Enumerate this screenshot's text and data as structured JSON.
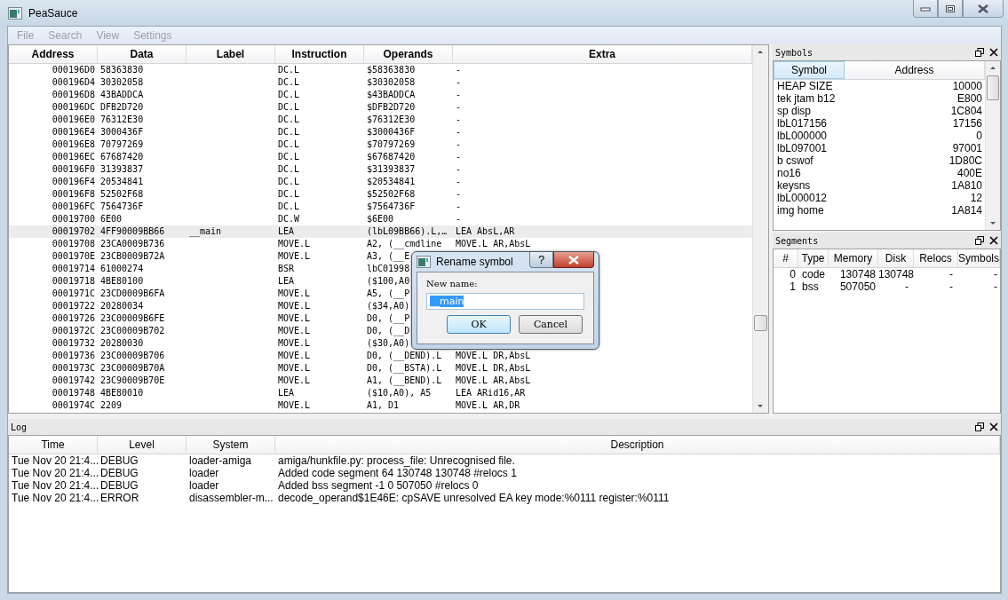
{
  "window": {
    "title": "PeaSauce"
  },
  "menu": [
    {
      "label": "File",
      "disabled": true
    },
    {
      "label": "Search",
      "disabled": true
    },
    {
      "label": "View",
      "disabled": true
    },
    {
      "label": "Settings",
      "disabled": true
    }
  ],
  "disassembly": {
    "columns": [
      "Address",
      "Data",
      "Label",
      "Instruction",
      "Operands",
      "Extra"
    ],
    "rows": [
      {
        "address": "000196D0",
        "data": "58363830",
        "instruction": "DC.L",
        "operands": "$58363830",
        "extra": "-",
        "selected": false
      },
      {
        "address": "000196D4",
        "data": "30302058",
        "instruction": "DC.L",
        "operands": "$30302058",
        "extra": "-",
        "selected": false
      },
      {
        "address": "000196D8",
        "data": "43BADDCA",
        "instruction": "DC.L",
        "operands": "$43BADDCA",
        "extra": "-",
        "selected": false
      },
      {
        "address": "000196DC",
        "data": "DFB2D720",
        "instruction": "DC.L",
        "operands": "$DFB2D720",
        "extra": "-",
        "selected": false
      },
      {
        "address": "000196E0",
        "data": "76312E30",
        "instruction": "DC.L",
        "operands": "$76312E30",
        "extra": "-",
        "selected": false
      },
      {
        "address": "000196E4",
        "data": "3000436F",
        "instruction": "DC.L",
        "operands": "$3000436F",
        "extra": "-",
        "selected": false
      },
      {
        "address": "000196E8",
        "data": "70797269",
        "instruction": "DC.L",
        "operands": "$70797269",
        "extra": "-",
        "selected": false
      },
      {
        "address": "000196EC",
        "data": "67687420",
        "instruction": "DC.L",
        "operands": "$67687420",
        "extra": "-",
        "selected": false
      },
      {
        "address": "000196F0",
        "data": "31393837",
        "instruction": "DC.L",
        "operands": "$31393837",
        "extra": "-",
        "selected": false
      },
      {
        "address": "000196F4",
        "data": "20534841",
        "instruction": "DC.L",
        "operands": "$20534841",
        "extra": "-",
        "selected": false
      },
      {
        "address": "000196F8",
        "data": "52502F68",
        "instruction": "DC.L",
        "operands": "$52502F68",
        "extra": "-",
        "selected": false
      },
      {
        "address": "000196FC",
        "data": "7564736F",
        "instruction": "DC.L",
        "operands": "$7564736F",
        "extra": "-",
        "selected": false
      },
      {
        "address": "00019700",
        "data": "6E00",
        "instruction": "DC.W",
        "operands": "$6E00",
        "extra": "-",
        "selected": false
      },
      {
        "address": "00019702",
        "data": "4FF90009BB66",
        "label": "__main",
        "instruction": "LEA",
        "operands": "(lbL09BB66).L,…",
        "extra": "LEA AbsL,AR",
        "selected": true
      },
      {
        "address": "00019708",
        "data": "23CA0009B736",
        "instruction": "MOVE.L",
        "operands": "A2, (__cmdline",
        "extra": "MOVE.L AR,AbsL",
        "selected": false
      },
      {
        "address": "0001970E",
        "data": "23CB0009B72A",
        "instruction": "MOVE.L",
        "operands": "A3, (__E",
        "selected": false
      },
      {
        "address": "00019714",
        "data": "61000274",
        "instruction": "BSR",
        "operands": "lbC01998",
        "selected": false
      },
      {
        "address": "00019718",
        "data": "4BE80100",
        "instruction": "LEA",
        "operands": "($100,A0",
        "selected": false
      },
      {
        "address": "0001971C",
        "data": "23CD0009B6FA",
        "instruction": "MOVE.L",
        "operands": "A5, (__P",
        "selected": false
      },
      {
        "address": "00019722",
        "data": "20280034",
        "instruction": "MOVE.L",
        "operands": "($34,A0)",
        "selected": false
      },
      {
        "address": "00019726",
        "data": "23C00009B6FE",
        "instruction": "MOVE.L",
        "operands": "D0, (__P",
        "selected": false
      },
      {
        "address": "0001972C",
        "data": "23C00009B702",
        "instruction": "MOVE.L",
        "operands": "D0, (__D",
        "selected": false
      },
      {
        "address": "00019732",
        "data": "20280030",
        "instruction": "MOVE.L",
        "operands": "($30,A0)",
        "selected": false
      },
      {
        "address": "00019736",
        "data": "23C00009B706",
        "instruction": "MOVE.L",
        "operands": "D0, (__DEND).L",
        "extra": "MOVE.L DR,AbsL",
        "selected": false
      },
      {
        "address": "0001973C",
        "data": "23C00009B70A",
        "instruction": "MOVE.L",
        "operands": "D0, (__BSTA).L",
        "extra": "MOVE.L DR,AbsL",
        "selected": false
      },
      {
        "address": "00019742",
        "data": "23C90009B70E",
        "instruction": "MOVE.L",
        "operands": "A1, (__BEND).L",
        "extra": "MOVE.L AR,AbsL",
        "selected": false
      },
      {
        "address": "00019748",
        "data": "4BE80010",
        "instruction": "LEA",
        "operands": "($10,A0), A5",
        "extra": "LEA ARid16,AR",
        "selected": false
      },
      {
        "address": "0001974C",
        "data": "2209",
        "instruction": "MOVE.L",
        "operands": "A1, D1",
        "extra": "MOVE.L AR,DR",
        "selected": false
      }
    ]
  },
  "symbols": {
    "title": "Symbols",
    "columns": [
      {
        "label": "Symbol",
        "selected": true
      },
      {
        "label": "Address",
        "selected": false
      }
    ],
    "rows": [
      {
        "symbol": "HEAP SIZE",
        "address": "10000"
      },
      {
        "symbol": "tek jtam b12",
        "address": "E800"
      },
      {
        "symbol": "sp disp",
        "address": "1C804"
      },
      {
        "symbol": "lbL017156",
        "address": "17156"
      },
      {
        "symbol": "lbL000000",
        "address": "0"
      },
      {
        "symbol": "lbL097001",
        "address": "97001"
      },
      {
        "symbol": "b cswof",
        "address": "1D80C"
      },
      {
        "symbol": "no16",
        "address": "400E"
      },
      {
        "symbol": "keysns",
        "address": "1A810"
      },
      {
        "symbol": "lbL000012",
        "address": "12"
      },
      {
        "symbol": "img home",
        "address": "1A814"
      }
    ]
  },
  "segments": {
    "title": "Segments",
    "columns": [
      "#",
      "Type",
      "Memory",
      "Disk",
      "Relocs",
      "Symbols"
    ],
    "rows": [
      {
        "number": "0",
        "type": "code",
        "memory": "130748",
        "disk": "130748",
        "relocs": "-",
        "symbols": "-"
      },
      {
        "number": "1",
        "type": "bss",
        "memory": "507050",
        "disk": "-",
        "relocs": "-",
        "symbols": "-"
      }
    ]
  },
  "log": {
    "title": "Log",
    "columns": [
      "Time",
      "Level",
      "System",
      "Description"
    ],
    "rows": [
      {
        "time": "Tue Nov 20 21:4...",
        "level": "DEBUG",
        "system": "loader-amiga",
        "description": "amiga/hunkfile.py:   process_file: Unrecognised file."
      },
      {
        "time": "Tue Nov 20 21:4...",
        "level": "DEBUG",
        "system": "loader",
        "description": "Added code segment 64 130748 130748 #relocs 1"
      },
      {
        "time": "Tue Nov 20 21:4...",
        "level": "DEBUG",
        "system": "loader",
        "description": "Added bss segment -1 0 507050 #relocs 0"
      },
      {
        "time": "Tue Nov 20 21:4...",
        "level": "ERROR",
        "system": "disassembler-m...",
        "description": "  decode_operand$1E46E: cpSAVE unresolved EA key mode:%0111 register:%0111"
      }
    ]
  },
  "dialog": {
    "title": "Rename symbol",
    "help": "?",
    "label": "New name:",
    "value": "__main",
    "buttons": [
      {
        "label": "OK",
        "default": true
      },
      {
        "label": "Cancel",
        "default": false
      }
    ]
  }
}
